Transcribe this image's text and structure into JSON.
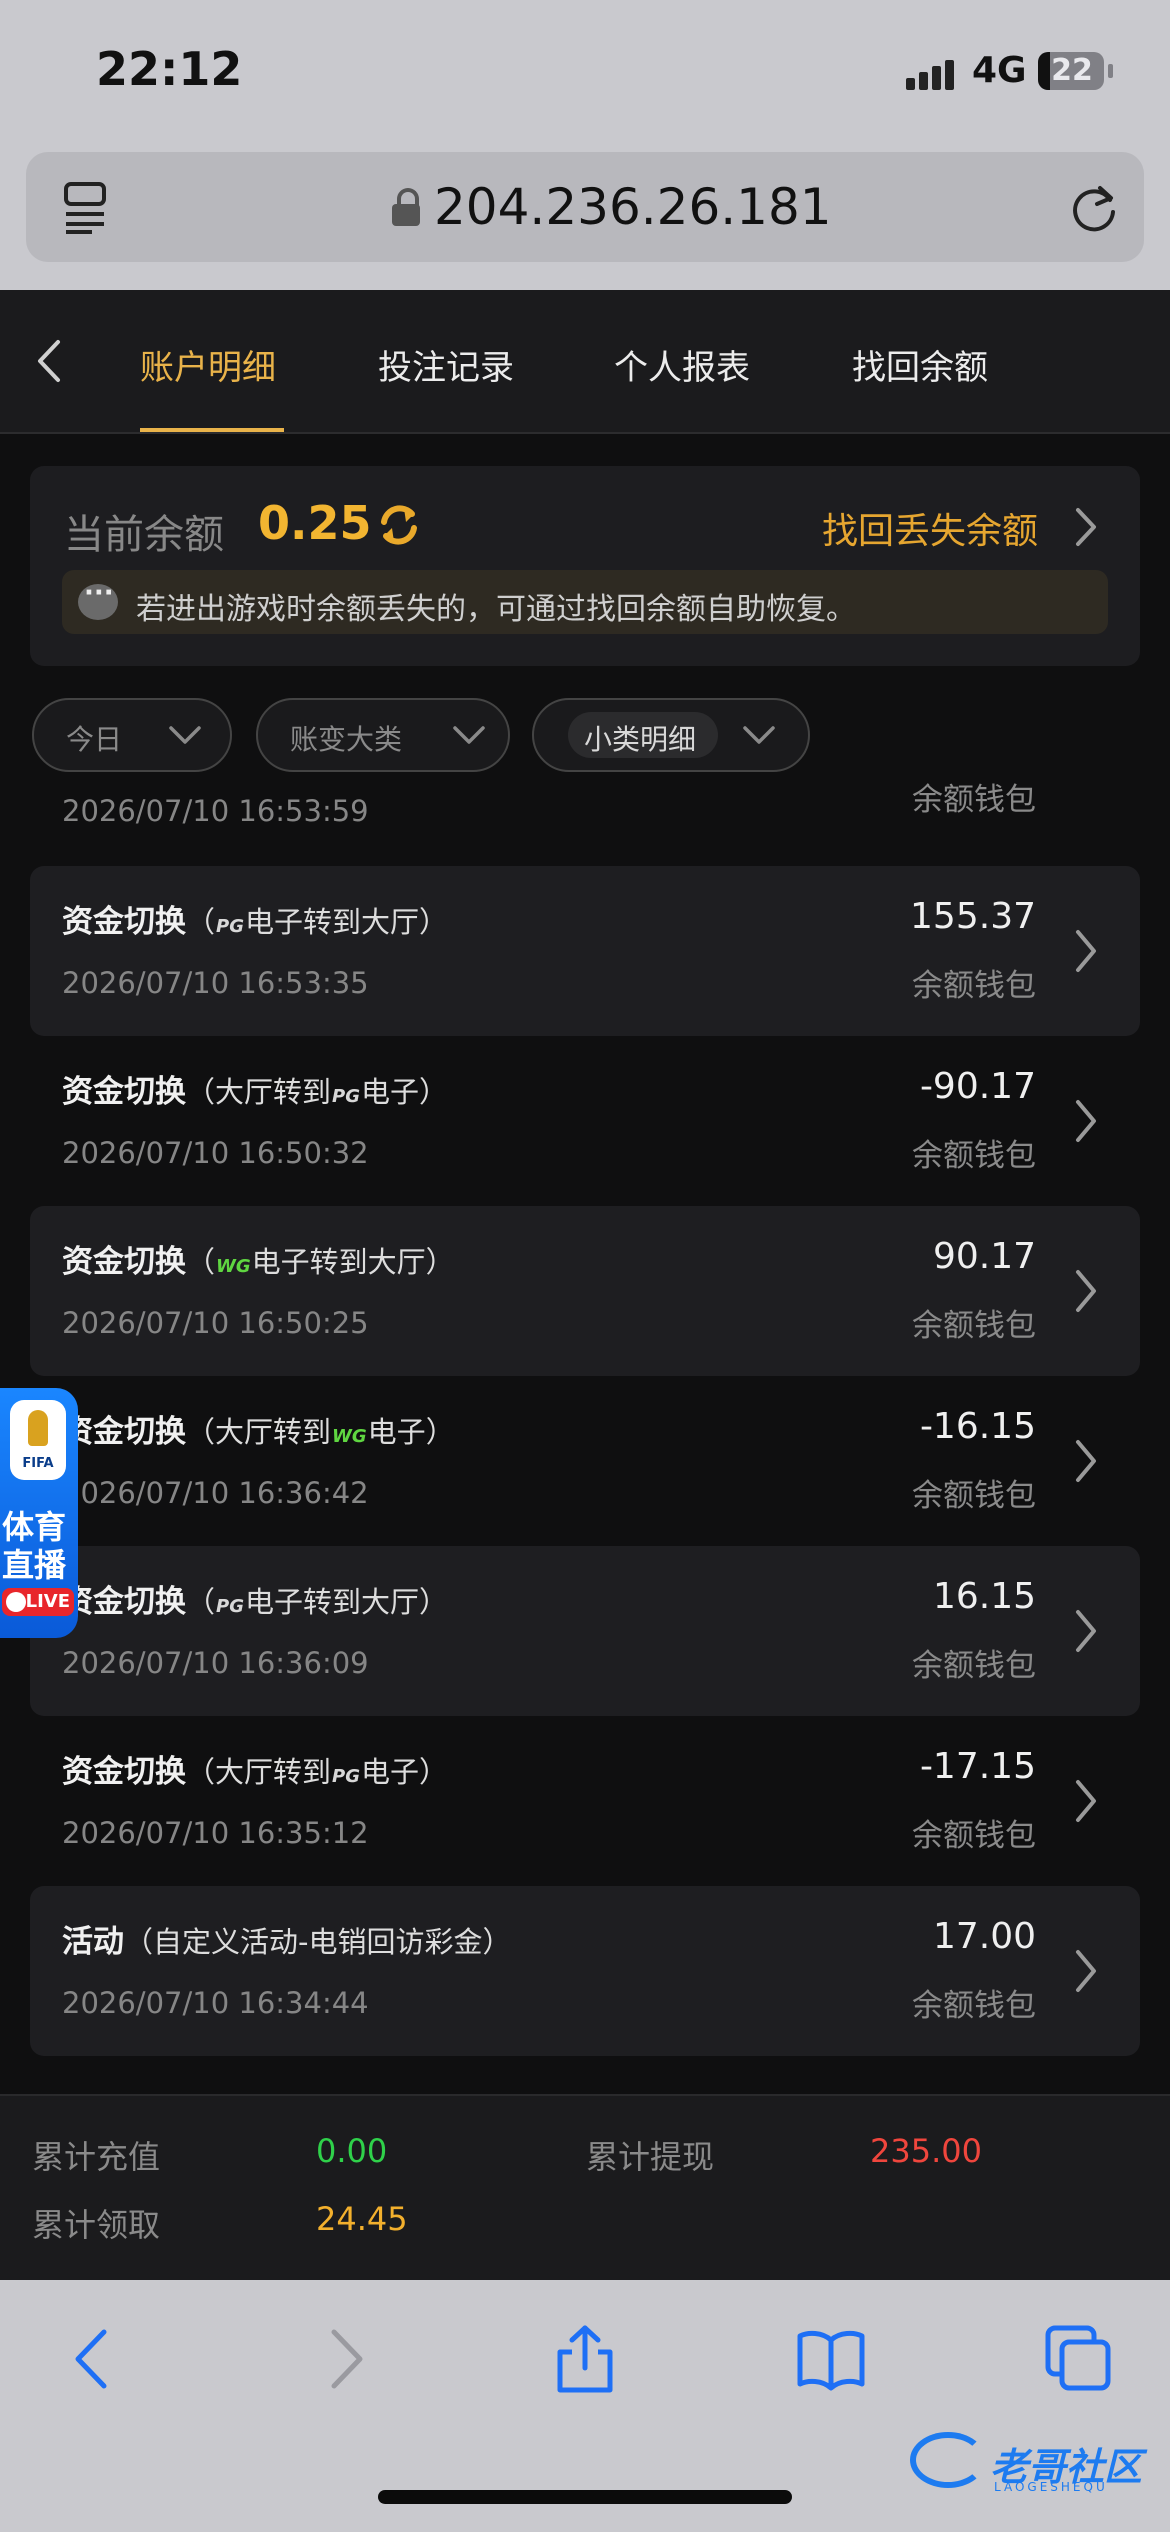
{
  "status_bar": {
    "time": "22:12",
    "network": "4G",
    "battery": "22"
  },
  "browser": {
    "url": "204.236.26.181"
  },
  "header": {
    "tabs": [
      {
        "label": "账户明细",
        "active": true
      },
      {
        "label": "投注记录",
        "active": false
      },
      {
        "label": "个人报表",
        "active": false
      },
      {
        "label": "找回余额",
        "active": false
      }
    ]
  },
  "balance": {
    "label": "当前余额",
    "value": "0.25",
    "recover_link": "找回丢失余额",
    "notice": "若进出游戏时余额丢失的，可通过找回余额自助恢复。"
  },
  "filters": [
    {
      "label": "今日"
    },
    {
      "label": "账变大类"
    },
    {
      "label": "小类明细"
    }
  ],
  "partial_row": {
    "time": "2026/07/10 16:53:59",
    "wallet": "余额钱包"
  },
  "records": [
    {
      "type": "资金切换",
      "open": "（",
      "pre": "",
      "badge": "PG",
      "post": "电子转到大厅",
      "close": "）",
      "time": "2026/07/10 16:53:35",
      "amount": "155.37",
      "wallet": "余额钱包"
    },
    {
      "type": "资金切换",
      "open": "（",
      "pre": "大厅转到",
      "badge": "PG",
      "post": "电子",
      "close": "）",
      "time": "2026/07/10 16:50:32",
      "amount": "-90.17",
      "wallet": "余额钱包"
    },
    {
      "type": "资金切换",
      "open": "（",
      "pre": "",
      "badge": "WG",
      "post": "电子转到大厅",
      "close": "）",
      "time": "2026/07/10 16:50:25",
      "amount": "90.17",
      "wallet": "余额钱包"
    },
    {
      "type": "资金切换",
      "open": "（",
      "pre": "大厅转到",
      "badge": "WG",
      "post": "电子",
      "close": "）",
      "time": "2026/07/10 16:36:42",
      "amount": "-16.15",
      "wallet": "余额钱包"
    },
    {
      "type": "资金切换",
      "open": "（",
      "pre": "",
      "badge": "PG",
      "post": "电子转到大厅",
      "close": "）",
      "time": "2026/07/10 16:36:09",
      "amount": "16.15",
      "wallet": "余额钱包"
    },
    {
      "type": "资金切换",
      "open": "（",
      "pre": "大厅转到",
      "badge": "PG",
      "post": "电子",
      "close": "）",
      "time": "2026/07/10 16:35:12",
      "amount": "-17.15",
      "wallet": "余额钱包"
    },
    {
      "type": "活动",
      "open": "（",
      "pre": "自定义活动-电销回访彩金",
      "badge": "",
      "post": "",
      "close": "）",
      "time": "2026/07/10 16:34:44",
      "amount": "17.00",
      "wallet": "余额钱包"
    }
  ],
  "side_widget": {
    "line1": "体育",
    "line2": "直播",
    "live": "LIVE",
    "fifa": "FIFA"
  },
  "totals": {
    "recharge_label": "累计充值",
    "recharge_value": "0.00",
    "withdraw_label": "累计提现",
    "withdraw_value": "235.00",
    "claim_label": "累计领取",
    "claim_value": "24.45"
  },
  "watermark": {
    "text": "老哥社区",
    "sub": "LAOGESHEQU"
  },
  "colors": {
    "accent": "#e9b34a",
    "positive": "#2fd14a",
    "negative": "#f0463d",
    "gold": "#f3b02d"
  }
}
